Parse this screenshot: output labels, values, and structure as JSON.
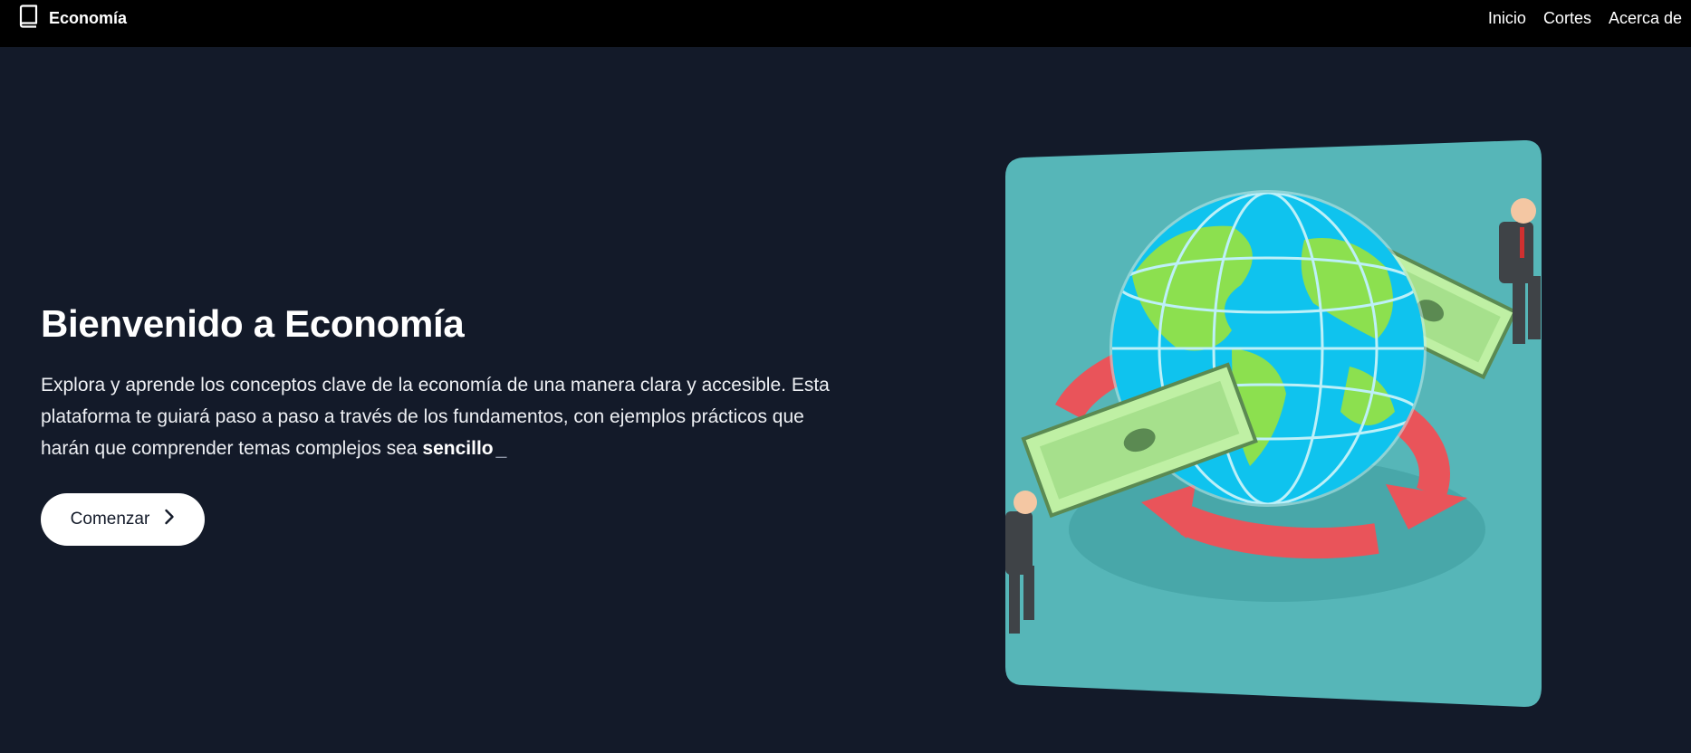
{
  "header": {
    "brand": "Economía",
    "nav": [
      {
        "label": "Inicio"
      },
      {
        "label": "Cortes"
      },
      {
        "label": "Acerca de"
      }
    ]
  },
  "hero": {
    "title": "Bienvenido a Economía",
    "description": "Explora y aprende los conceptos clave de la economía de una manera clara y accesible. Esta plataforma te guiará paso a paso a través de los fundamentos, con ejemplos prácticos que harán que comprender temas complejos sea",
    "highlight": "sencillo",
    "cursor": "_",
    "cta_label": "Comenzar"
  },
  "colors": {
    "background": "#131a29",
    "navbar": "#000000",
    "illustration_bg": "#56b6b8",
    "button": "#ffffff"
  },
  "icons": {
    "brand": "book-icon",
    "cta": "chevron-right-icon"
  }
}
